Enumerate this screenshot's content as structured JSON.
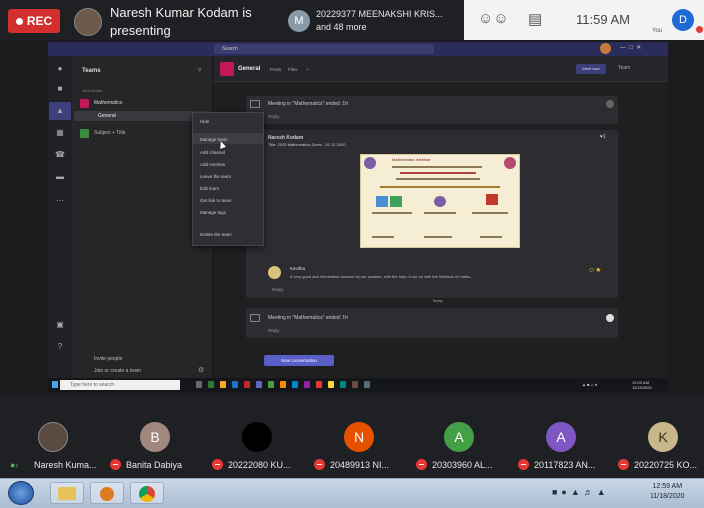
{
  "meeting": {
    "rec_label": "REC",
    "presenter_text": "Naresh Kumar Kodam is presenting",
    "others_avatar_letter": "M",
    "others_text": "20229377 MEENAKSHI KRIS... and 48 more",
    "time": "11:59 AM",
    "you_avatar_letter": "D",
    "you_label": "You",
    "people_icon": "people-icon",
    "chat_icon": "chat-icon"
  },
  "teams": {
    "search_placeholder": "Search",
    "panel_title": "Teams",
    "your_teams_label": "Your teams",
    "team1_name": "Mathematics",
    "general_channel": "General",
    "team2_name": "Subject + Title",
    "invite_people": "Invite people",
    "join_create": "Join or create a team",
    "context_menu": [
      "Hide",
      "Manage team",
      "Add channel",
      "Add member",
      "Leave the team",
      "Edit team",
      "Get link to team",
      "Manage tags",
      "Delete the team"
    ],
    "channel_name": "General",
    "channel_tabs": [
      "Posts",
      "Files",
      "+"
    ],
    "meet_button": "Meet now",
    "team_more": "Team",
    "card1_title": "Meeting in \"Mathematics\" ended: 1h",
    "card1_reply": "Reply",
    "card2_author": "Naresh Kodam",
    "card2_title": "Title: 2020 Mathematics-Zoom - 20 12 2020",
    "poster_title": "Mathematics Webinar",
    "reply_name": "Kavitha",
    "reply_text": "A very good and informative session by our speaker, with the help of our sir with the Webinar of maths...",
    "reply_link": "Reply",
    "separator_label": "Today",
    "card3_title": "Meeting in \"Mathematics\" ended: 1h",
    "card3_reply": "Reply",
    "new_conversation": "New conversation",
    "taskbar_search": "Type here to search",
    "taskbar_time": "12:02 AM",
    "taskbar_date": "11/19/2020"
  },
  "participants": [
    {
      "letter": "",
      "label": "Naresh Kuma...",
      "color": "#5a4a3f"
    },
    {
      "letter": "B",
      "label": "Banita Dabiya",
      "color": "#a1887f"
    },
    {
      "letter": "",
      "label": "20222080 KU...",
      "color": "#000000"
    },
    {
      "letter": "N",
      "label": "20489913 NI...",
      "color": "#e65100"
    },
    {
      "letter": "A",
      "label": "20303960 AL...",
      "color": "#43a047"
    },
    {
      "letter": "A",
      "label": "20117823 AN...",
      "color": "#7e57c2"
    },
    {
      "letter": "K",
      "label": "20220725 KO...",
      "color": "#c8b78a"
    }
  ],
  "host_taskbar": {
    "time": "12:59 AM",
    "date": "11/18/2020"
  }
}
